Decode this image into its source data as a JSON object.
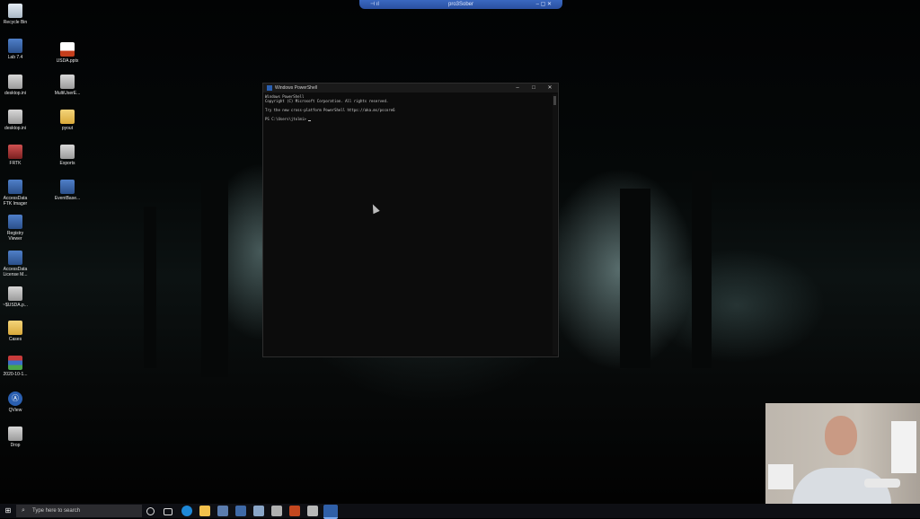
{
  "remote_session": {
    "title": "pro3Sober",
    "left_controls": "⊣ ıl",
    "right_controls": "– ▢ ✕"
  },
  "desktop": {
    "icons": [
      {
        "label": "Recycle Bin",
        "kind": "bin"
      },
      {
        "label": "Lab 7.4",
        "kind": "app"
      },
      {
        "label": "USDA.pptx",
        "kind": "pptx"
      },
      {
        "label": "desktop.ini",
        "kind": "file"
      },
      {
        "label": "MultiUserE...",
        "kind": "file"
      },
      {
        "label": "desktop.ini",
        "kind": "file"
      },
      {
        "label": "pyout",
        "kind": "folder"
      },
      {
        "label": "FRTK",
        "kind": "red"
      },
      {
        "label": "Exports",
        "kind": "file"
      },
      {
        "label": "AccessData FTK Imager",
        "kind": "app"
      },
      {
        "label": "EventBase...",
        "kind": "app"
      },
      {
        "label": "Registry Viewer",
        "kind": "app"
      },
      {
        "label": "AccessData License M...",
        "kind": "app"
      },
      {
        "label": "~$USDA.p...",
        "kind": "file"
      },
      {
        "label": "Cases",
        "kind": "folder"
      },
      {
        "label": "2020-10-1...",
        "kind": "rar"
      },
      {
        "label": "QView",
        "kind": "qview"
      },
      {
        "label": "Drop",
        "kind": "file"
      }
    ]
  },
  "powershell": {
    "title": "Windows PowerShell",
    "lines": [
      "Windows PowerShell",
      "Copyright (C) Microsoft Corporation. All rights reserved.",
      "",
      "Try the new cross-platform PowerShell https://aka.ms/pscore6",
      "",
      "PS C:\\Users\\jtolmi> "
    ],
    "controls": {
      "minimize": "–",
      "maximize": "□",
      "close": "✕"
    }
  },
  "taskbar": {
    "start_icon": "windows-icon",
    "search_placeholder": "Type here to search",
    "apps": [
      "cortana-icon",
      "task-view-icon",
      "edge-icon",
      "file-explorer-icon",
      "vmware-icon",
      "ftk-icon",
      "app-icon",
      "app-icon",
      "powerpoint-icon",
      "app-icon",
      "powershell-icon"
    ]
  },
  "colors": {
    "taskbar": "#0e0f14",
    "powershell_bg": "#0c0c0c",
    "remote_bar": "#2a50a0"
  }
}
